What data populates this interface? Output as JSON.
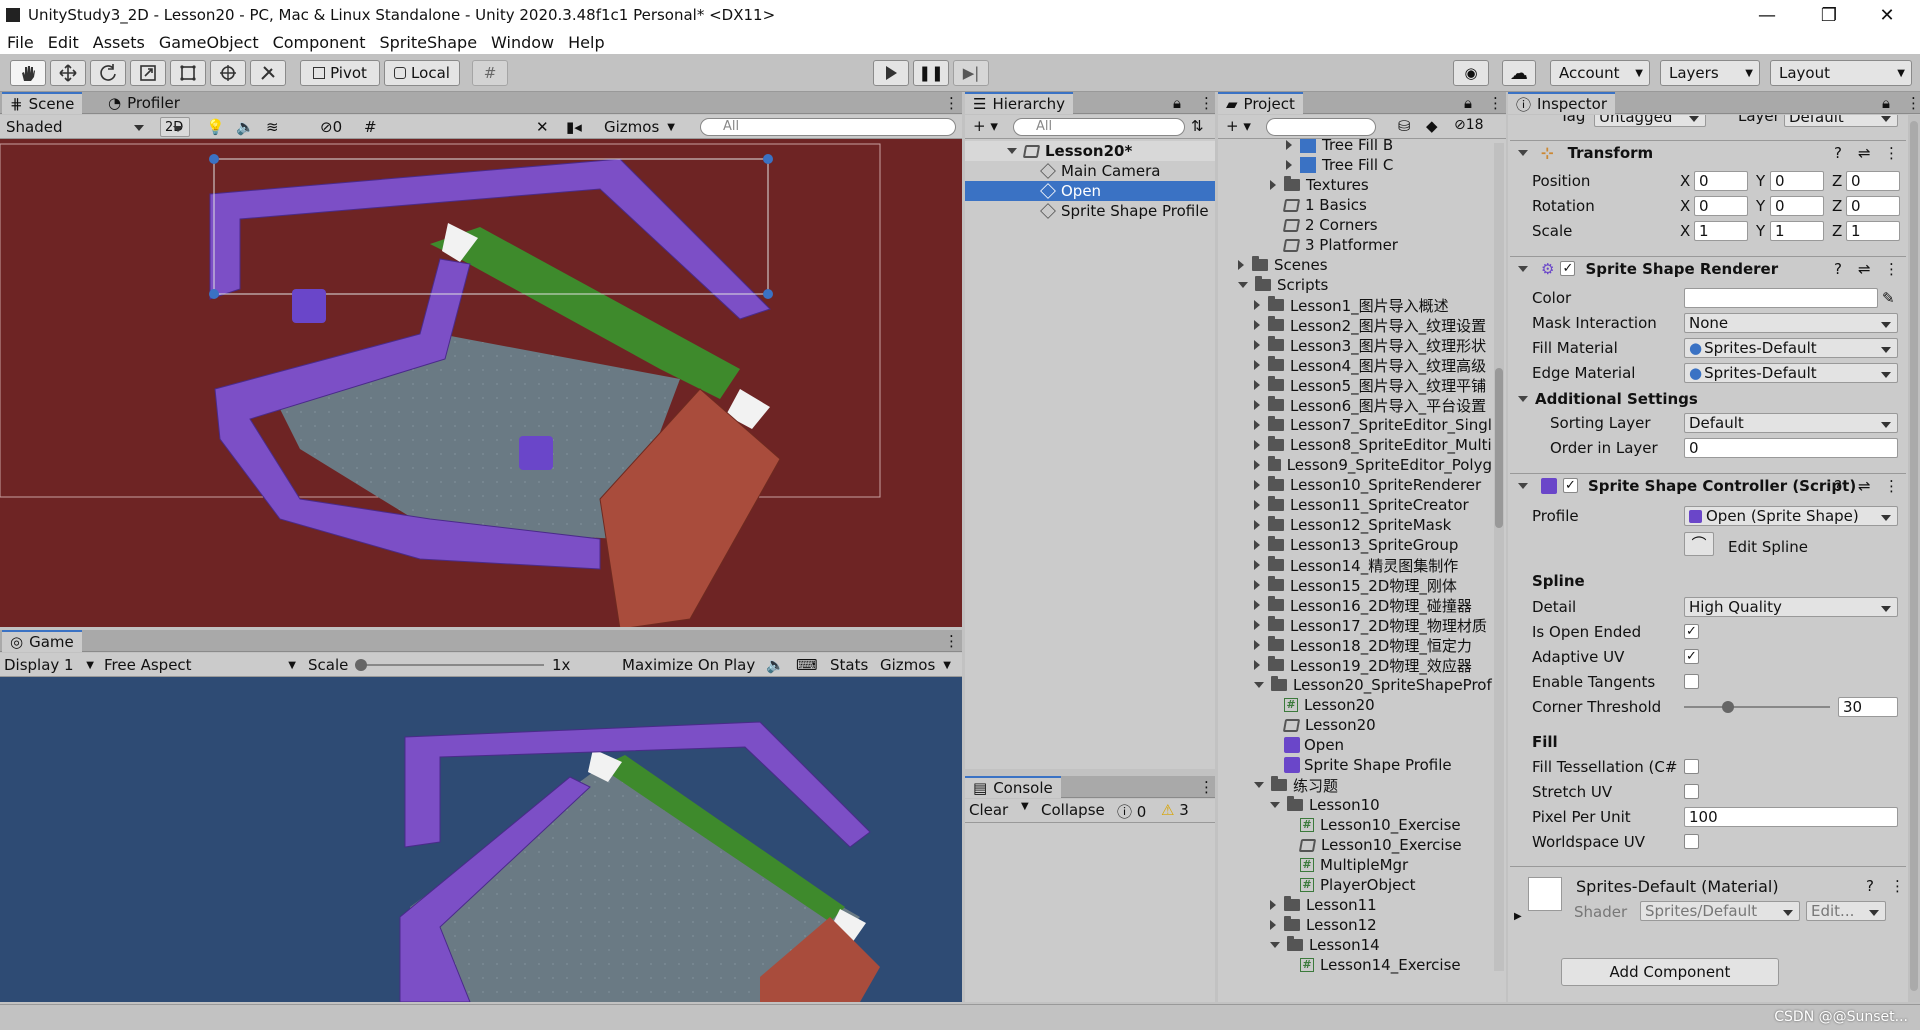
{
  "window": {
    "title": "UnityStudy3_2D - Lesson20 - PC, Mac & Linux Standalone - Unity 2020.3.48f1c1 Personal* <DX11>"
  },
  "menu": [
    "File",
    "Edit",
    "Assets",
    "GameObject",
    "Component",
    "SpriteShape",
    "Window",
    "Help"
  ],
  "toolbar": {
    "pivot": "Pivot",
    "local": "Local",
    "account": "Account",
    "layers": "Layers",
    "layout": "Layout"
  },
  "scene": {
    "tab": "Scene",
    "tab2": "Profiler",
    "shading": "Shaded",
    "mode2d": "2D",
    "hidden_count": "0",
    "gizmos": "Gizmos",
    "search_placeholder": "All"
  },
  "game": {
    "tab": "Game",
    "display": "Display 1",
    "aspect": "Free Aspect",
    "scale_label": "Scale",
    "scale_value": "1x",
    "maximize": "Maximize On Play",
    "stats": "Stats",
    "gizmos": "Gizmos"
  },
  "hierarchy": {
    "tab": "Hierarchy",
    "search_placeholder": "All",
    "root": "Lesson20*",
    "items": [
      "Main Camera",
      "Open",
      "Sprite Shape Profile"
    ]
  },
  "console": {
    "tab": "Console",
    "clear": "Clear",
    "collapse": "Collapse",
    "errors": "0",
    "warnings": "3"
  },
  "project": {
    "tab": "Project",
    "count": "18",
    "items": [
      {
        "label": "Tree Fill B",
        "indent": 3,
        "icon": "tex",
        "arrow": "right"
      },
      {
        "label": "Tree Fill C",
        "indent": 3,
        "icon": "tex",
        "arrow": "right"
      },
      {
        "label": "Textures",
        "indent": 2,
        "icon": "folder",
        "arrow": "right"
      },
      {
        "label": "1 Basics",
        "indent": 2,
        "icon": "scene",
        "arrow": ""
      },
      {
        "label": "2 Corners",
        "indent": 2,
        "icon": "scene",
        "arrow": ""
      },
      {
        "label": "3 Platformer",
        "indent": 2,
        "icon": "scene",
        "arrow": ""
      },
      {
        "label": "Scenes",
        "indent": 0,
        "icon": "folder",
        "arrow": "right"
      },
      {
        "label": "Scripts",
        "indent": 0,
        "icon": "folder",
        "arrow": "down"
      },
      {
        "label": "Lesson1_图片导入概述",
        "indent": 1,
        "icon": "folder",
        "arrow": "right"
      },
      {
        "label": "Lesson2_图片导入_纹理设置",
        "indent": 1,
        "icon": "folder",
        "arrow": "right"
      },
      {
        "label": "Lesson3_图片导入_纹理形状",
        "indent": 1,
        "icon": "folder",
        "arrow": "right"
      },
      {
        "label": "Lesson4_图片导入_纹理高级",
        "indent": 1,
        "icon": "folder",
        "arrow": "right"
      },
      {
        "label": "Lesson5_图片导入_纹理平铺",
        "indent": 1,
        "icon": "folder",
        "arrow": "right"
      },
      {
        "label": "Lesson6_图片导入_平台设置",
        "indent": 1,
        "icon": "folder",
        "arrow": "right"
      },
      {
        "label": "Lesson7_SpriteEditor_Singl",
        "indent": 1,
        "icon": "folder",
        "arrow": "right"
      },
      {
        "label": "Lesson8_SpriteEditor_Multi",
        "indent": 1,
        "icon": "folder",
        "arrow": "right"
      },
      {
        "label": "Lesson9_SpriteEditor_Polyg",
        "indent": 1,
        "icon": "folder",
        "arrow": "right"
      },
      {
        "label": "Lesson10_SpriteRenderer",
        "indent": 1,
        "icon": "folder",
        "arrow": "right"
      },
      {
        "label": "Lesson11_SpriteCreator",
        "indent": 1,
        "icon": "folder",
        "arrow": "right"
      },
      {
        "label": "Lesson12_SpriteMask",
        "indent": 1,
        "icon": "folder",
        "arrow": "right"
      },
      {
        "label": "Lesson13_SpriteGroup",
        "indent": 1,
        "icon": "folder",
        "arrow": "right"
      },
      {
        "label": "Lesson14_精灵图集制作",
        "indent": 1,
        "icon": "folder",
        "arrow": "right"
      },
      {
        "label": "Lesson15_2D物理_刚体",
        "indent": 1,
        "icon": "folder",
        "arrow": "right"
      },
      {
        "label": "Lesson16_2D物理_碰撞器",
        "indent": 1,
        "icon": "folder",
        "arrow": "right"
      },
      {
        "label": "Lesson17_2D物理_物理材质",
        "indent": 1,
        "icon": "folder",
        "arrow": "right"
      },
      {
        "label": "Lesson18_2D物理_恒定力",
        "indent": 1,
        "icon": "folder",
        "arrow": "right"
      },
      {
        "label": "Lesson19_2D物理_效应器",
        "indent": 1,
        "icon": "folder",
        "arrow": "right"
      },
      {
        "label": "Lesson20_SpriteShapeProf",
        "indent": 1,
        "icon": "folder",
        "arrow": "down"
      },
      {
        "label": "Lesson20",
        "indent": 2,
        "icon": "cs",
        "arrow": ""
      },
      {
        "label": "Lesson20",
        "indent": 2,
        "icon": "scene",
        "arrow": ""
      },
      {
        "label": "Open",
        "indent": 2,
        "icon": "shape",
        "arrow": ""
      },
      {
        "label": "Sprite Shape Profile",
        "indent": 2,
        "icon": "shape",
        "arrow": ""
      },
      {
        "label": "练习题",
        "indent": 1,
        "icon": "folder",
        "arrow": "down"
      },
      {
        "label": "Lesson10",
        "indent": 2,
        "icon": "folder",
        "arrow": "down"
      },
      {
        "label": "Lesson10_Exercise",
        "indent": 3,
        "icon": "cs",
        "arrow": ""
      },
      {
        "label": "Lesson10_Exercise",
        "indent": 3,
        "icon": "scene",
        "arrow": ""
      },
      {
        "label": "MultipleMgr",
        "indent": 3,
        "icon": "cs",
        "arrow": ""
      },
      {
        "label": "PlayerObject",
        "indent": 3,
        "icon": "cs",
        "arrow": ""
      },
      {
        "label": "Lesson11",
        "indent": 2,
        "icon": "folder",
        "arrow": "right"
      },
      {
        "label": "Lesson12",
        "indent": 2,
        "icon": "folder",
        "arrow": "right"
      },
      {
        "label": "Lesson14",
        "indent": 2,
        "icon": "folder",
        "arrow": "down"
      },
      {
        "label": "Lesson14_Exercise",
        "indent": 3,
        "icon": "cs",
        "arrow": ""
      }
    ]
  },
  "inspector": {
    "tab": "Inspector",
    "tag_label": "Tag",
    "tag_value": "Untagged",
    "layer_label": "Layer",
    "layer_value": "Default",
    "transform": {
      "title": "Transform",
      "position": {
        "label": "Position",
        "x": "0",
        "y": "0",
        "z": "0"
      },
      "rotation": {
        "label": "Rotation",
        "x": "0",
        "y": "0",
        "z": "0"
      },
      "scale": {
        "label": "Scale",
        "x": "1",
        "y": "1",
        "z": "1"
      }
    },
    "renderer": {
      "title": "Sprite Shape Renderer",
      "color": "Color",
      "mask_label": "Mask Interaction",
      "mask_value": "None",
      "fill_label": "Fill Material",
      "fill_value": "Sprites-Default",
      "edge_label": "Edge Material",
      "edge_value": "Sprites-Default",
      "additional": "Additional Settings",
      "sorting_label": "Sorting Layer",
      "sorting_value": "Default",
      "order_label": "Order in Layer",
      "order_value": "0"
    },
    "controller": {
      "title": "Sprite Shape Controller (Script)",
      "profile_label": "Profile",
      "profile_value": "Open (Sprite Shape)",
      "edit_spline": "Edit Spline",
      "spline": "Spline",
      "detail_label": "Detail",
      "detail_value": "High Quality",
      "open_ended": "Is Open Ended",
      "adaptive": "Adaptive UV",
      "tangents": "Enable Tangents",
      "corner_label": "Corner Threshold",
      "corner_value": "30",
      "corner_fraction": 0.3,
      "fill": "Fill",
      "tess": "Fill Tessellation (C#",
      "stretch": "Stretch UV",
      "ppu_label": "Pixel Per Unit",
      "ppu_value": "100",
      "world": "Worldspace UV"
    },
    "material": {
      "title": "Sprites-Default (Material)",
      "shader_label": "Shader",
      "shader_value": "Sprites/Default",
      "edit": "Edit..."
    },
    "add_component": "Add Component"
  },
  "watermark": "CSDN @@Sunset...",
  "colors": {
    "scene_bg": "#6e2424",
    "game_bg": "#2e4b74",
    "selection": "#3a72c4",
    "purple": "#7c4fc6",
    "grass": "#3e8a2c",
    "brick": "#a94c3c"
  }
}
